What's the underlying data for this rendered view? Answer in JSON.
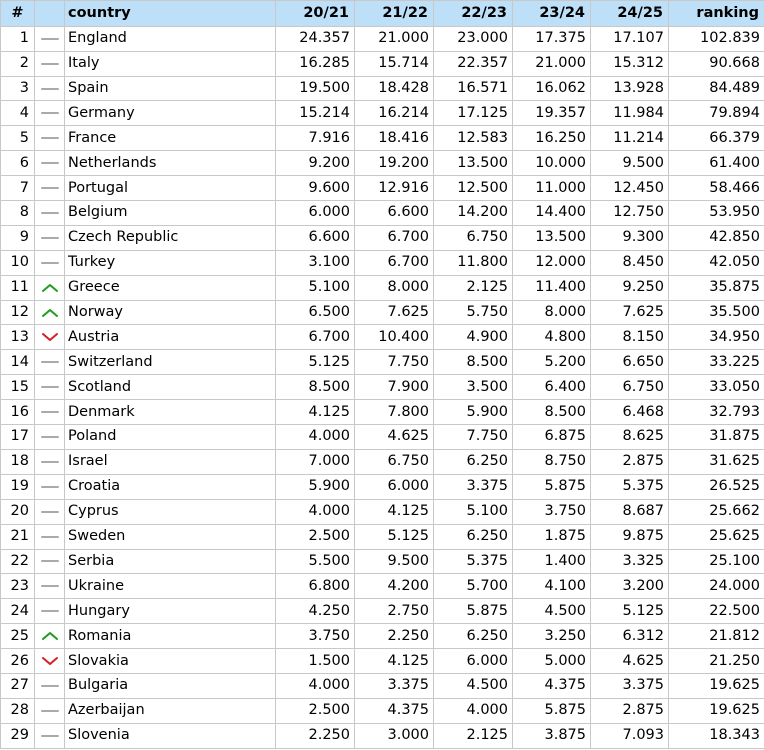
{
  "header": {
    "num": "#",
    "trend": "",
    "country": "country",
    "seasons": [
      "20/21",
      "21/22",
      "22/23",
      "23/24",
      "24/25"
    ],
    "ranking": "ranking"
  },
  "colors": {
    "header_bg": "#bddff7",
    "trend_same": "#aaaaaa",
    "trend_up": "#1e9e1e",
    "trend_down": "#d42020"
  },
  "rows": [
    {
      "num": "1",
      "trend": "same",
      "country": "England",
      "values": [
        "24.357",
        "21.000",
        "23.000",
        "17.375",
        "17.107"
      ],
      "ranking": "102.839"
    },
    {
      "num": "2",
      "trend": "same",
      "country": "Italy",
      "values": [
        "16.285",
        "15.714",
        "22.357",
        "21.000",
        "15.312"
      ],
      "ranking": "90.668"
    },
    {
      "num": "3",
      "trend": "same",
      "country": "Spain",
      "values": [
        "19.500",
        "18.428",
        "16.571",
        "16.062",
        "13.928"
      ],
      "ranking": "84.489"
    },
    {
      "num": "4",
      "trend": "same",
      "country": "Germany",
      "values": [
        "15.214",
        "16.214",
        "17.125",
        "19.357",
        "11.984"
      ],
      "ranking": "79.894"
    },
    {
      "num": "5",
      "trend": "same",
      "country": "France",
      "values": [
        "7.916",
        "18.416",
        "12.583",
        "16.250",
        "11.214"
      ],
      "ranking": "66.379"
    },
    {
      "num": "6",
      "trend": "same",
      "country": "Netherlands",
      "values": [
        "9.200",
        "19.200",
        "13.500",
        "10.000",
        "9.500"
      ],
      "ranking": "61.400"
    },
    {
      "num": "7",
      "trend": "same",
      "country": "Portugal",
      "values": [
        "9.600",
        "12.916",
        "12.500",
        "11.000",
        "12.450"
      ],
      "ranking": "58.466"
    },
    {
      "num": "8",
      "trend": "same",
      "country": "Belgium",
      "values": [
        "6.000",
        "6.600",
        "14.200",
        "14.400",
        "12.750"
      ],
      "ranking": "53.950"
    },
    {
      "num": "9",
      "trend": "same",
      "country": "Czech Republic",
      "values": [
        "6.600",
        "6.700",
        "6.750",
        "13.500",
        "9.300"
      ],
      "ranking": "42.850"
    },
    {
      "num": "10",
      "trend": "same",
      "country": "Turkey",
      "values": [
        "3.100",
        "6.700",
        "11.800",
        "12.000",
        "8.450"
      ],
      "ranking": "42.050"
    },
    {
      "num": "11",
      "trend": "up",
      "country": "Greece",
      "values": [
        "5.100",
        "8.000",
        "2.125",
        "11.400",
        "9.250"
      ],
      "ranking": "35.875"
    },
    {
      "num": "12",
      "trend": "up",
      "country": "Norway",
      "values": [
        "6.500",
        "7.625",
        "5.750",
        "8.000",
        "7.625"
      ],
      "ranking": "35.500"
    },
    {
      "num": "13",
      "trend": "down",
      "country": "Austria",
      "values": [
        "6.700",
        "10.400",
        "4.900",
        "4.800",
        "8.150"
      ],
      "ranking": "34.950"
    },
    {
      "num": "14",
      "trend": "same",
      "country": "Switzerland",
      "values": [
        "5.125",
        "7.750",
        "8.500",
        "5.200",
        "6.650"
      ],
      "ranking": "33.225"
    },
    {
      "num": "15",
      "trend": "same",
      "country": "Scotland",
      "values": [
        "8.500",
        "7.900",
        "3.500",
        "6.400",
        "6.750"
      ],
      "ranking": "33.050"
    },
    {
      "num": "16",
      "trend": "same",
      "country": "Denmark",
      "values": [
        "4.125",
        "7.800",
        "5.900",
        "8.500",
        "6.468"
      ],
      "ranking": "32.793"
    },
    {
      "num": "17",
      "trend": "same",
      "country": "Poland",
      "values": [
        "4.000",
        "4.625",
        "7.750",
        "6.875",
        "8.625"
      ],
      "ranking": "31.875"
    },
    {
      "num": "18",
      "trend": "same",
      "country": "Israel",
      "values": [
        "7.000",
        "6.750",
        "6.250",
        "8.750",
        "2.875"
      ],
      "ranking": "31.625"
    },
    {
      "num": "19",
      "trend": "same",
      "country": "Croatia",
      "values": [
        "5.900",
        "6.000",
        "3.375",
        "5.875",
        "5.375"
      ],
      "ranking": "26.525"
    },
    {
      "num": "20",
      "trend": "same",
      "country": "Cyprus",
      "values": [
        "4.000",
        "4.125",
        "5.100",
        "3.750",
        "8.687"
      ],
      "ranking": "25.662"
    },
    {
      "num": "21",
      "trend": "same",
      "country": "Sweden",
      "values": [
        "2.500",
        "5.125",
        "6.250",
        "1.875",
        "9.875"
      ],
      "ranking": "25.625"
    },
    {
      "num": "22",
      "trend": "same",
      "country": "Serbia",
      "values": [
        "5.500",
        "9.500",
        "5.375",
        "1.400",
        "3.325"
      ],
      "ranking": "25.100"
    },
    {
      "num": "23",
      "trend": "same",
      "country": "Ukraine",
      "values": [
        "6.800",
        "4.200",
        "5.700",
        "4.100",
        "3.200"
      ],
      "ranking": "24.000"
    },
    {
      "num": "24",
      "trend": "same",
      "country": "Hungary",
      "values": [
        "4.250",
        "2.750",
        "5.875",
        "4.500",
        "5.125"
      ],
      "ranking": "22.500"
    },
    {
      "num": "25",
      "trend": "up",
      "country": "Romania",
      "values": [
        "3.750",
        "2.250",
        "6.250",
        "3.250",
        "6.312"
      ],
      "ranking": "21.812"
    },
    {
      "num": "26",
      "trend": "down",
      "country": "Slovakia",
      "values": [
        "1.500",
        "4.125",
        "6.000",
        "5.000",
        "4.625"
      ],
      "ranking": "21.250"
    },
    {
      "num": "27",
      "trend": "same",
      "country": "Bulgaria",
      "values": [
        "4.000",
        "3.375",
        "4.500",
        "4.375",
        "3.375"
      ],
      "ranking": "19.625"
    },
    {
      "num": "28",
      "trend": "same",
      "country": "Azerbaijan",
      "values": [
        "2.500",
        "4.375",
        "4.000",
        "5.875",
        "2.875"
      ],
      "ranking": "19.625"
    },
    {
      "num": "29",
      "trend": "same",
      "country": "Slovenia",
      "values": [
        "2.250",
        "3.000",
        "2.125",
        "3.875",
        "7.093"
      ],
      "ranking": "18.343"
    }
  ]
}
